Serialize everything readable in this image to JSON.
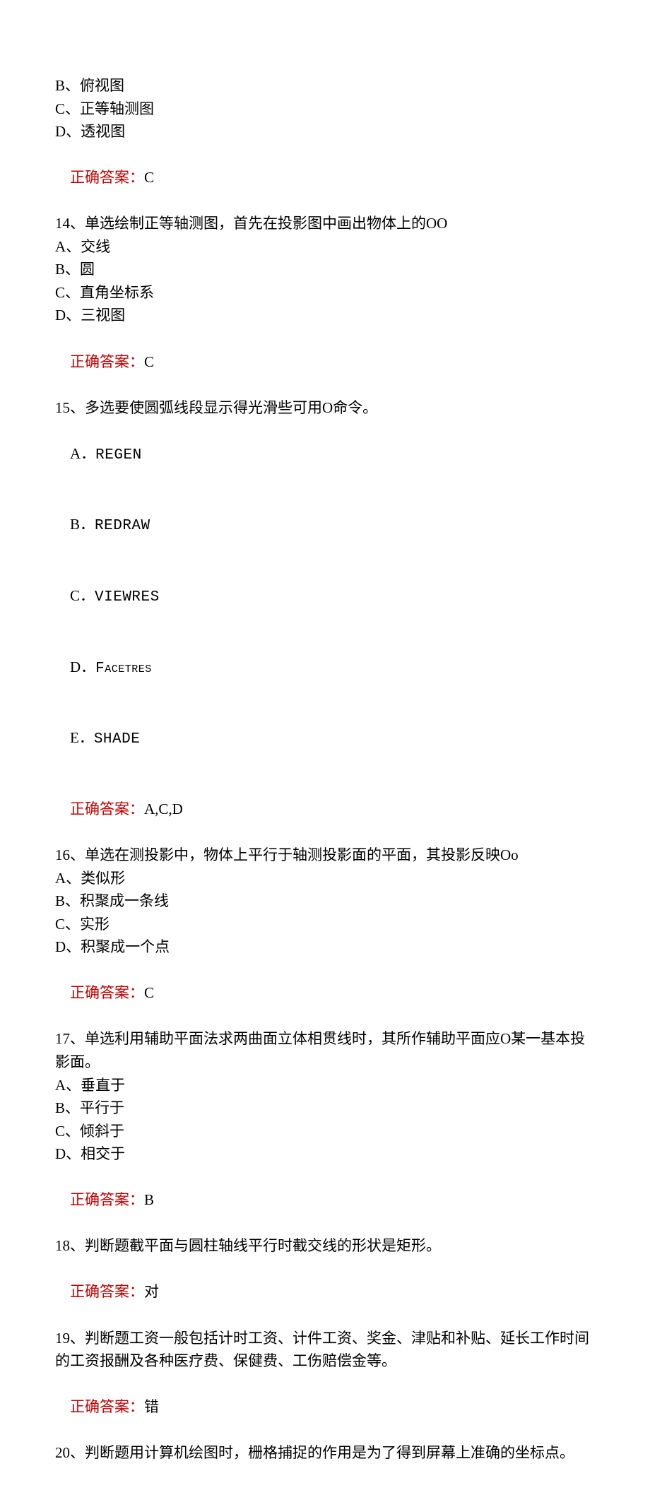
{
  "q13": {
    "opt_b": "B、俯视图",
    "opt_c": "C、正等轴测图",
    "opt_d": "D、透视图",
    "answer_label": "正确答案：",
    "answer_value": "C"
  },
  "q14": {
    "stem": "14、单选绘制正等轴测图，首先在投影图中画出物体上的OO",
    "opt_a": "A、交线",
    "opt_b": "B、圆",
    "opt_c": "C、直角坐标系",
    "opt_d": "D、三视图",
    "answer_label": "正确答案：",
    "answer_value": "C"
  },
  "q15": {
    "stem": "15、多选要使圆弧线段显示得光滑些可用O命令。",
    "opt_a_prefix": "A．",
    "opt_a_value": "REGEN",
    "opt_b_prefix": "B．",
    "opt_b_value": "REDRAW",
    "opt_c_prefix": "C．",
    "opt_c_value": "VIEWRES",
    "opt_d_prefix": "D．",
    "opt_d_value": "Facetres",
    "opt_e_prefix": "E．",
    "opt_e_value": "SHADE",
    "answer_label": "正确答案：",
    "answer_value": "A,C,D"
  },
  "q16": {
    "stem": "16、单选在测投影中，物体上平行于轴测投影面的平面，其投影反映Oo",
    "opt_a": "A、类似形",
    "opt_b": "B、积聚成一条线",
    "opt_c": "C、实形",
    "opt_d": "D、积聚成一个点",
    "answer_label": "正确答案：",
    "answer_value": "C"
  },
  "q17": {
    "stem": "17、单选利用辅助平面法求两曲面立体相贯线时，其所作辅助平面应O某一基本投影面。",
    "opt_a": "A、垂直于",
    "opt_b": "B、平行于",
    "opt_c": "C、倾斜于",
    "opt_d": "D、相交于",
    "answer_label": "正确答案：",
    "answer_value": "B"
  },
  "q18": {
    "stem": "18、判断题截平面与圆柱轴线平行时截交线的形状是矩形。",
    "answer_label": "正确答案：",
    "answer_value": "对"
  },
  "q19": {
    "stem": "19、判断题工资一般包括计时工资、计件工资、奖金、津贴和补贴、延长工作时间的工资报酬及各种医疗费、保健费、工伤赔偿金等。",
    "answer_label": "正确答案：",
    "answer_value": "错"
  },
  "q20": {
    "stem": "20、判断题用计算机绘图时，栅格捕捉的作用是为了得到屏幕上准确的坐标点。"
  }
}
